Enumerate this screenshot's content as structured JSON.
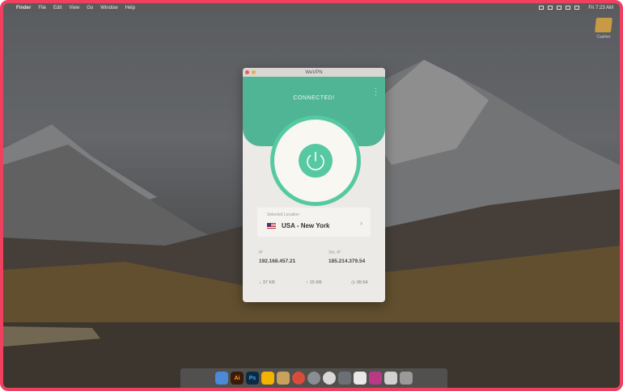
{
  "menubar": {
    "apple": "",
    "menus": [
      "Finder",
      "File",
      "Edit",
      "View",
      "Go",
      "Window",
      "Help"
    ],
    "clock": "Fri 7:23 AM"
  },
  "desktop": {
    "icon_label": "Cashier"
  },
  "app": {
    "title": "WeVPN",
    "status": "CONNECTED!",
    "location_label": "Selected Location",
    "location_value": "USA - New York",
    "ip_label": "IP",
    "ip_value": "192.168.457.21",
    "virtual_ip_label": "Virt. IP",
    "virtual_ip_value": "185.214.379.54",
    "download": "37 KB",
    "upload": "15 KB",
    "timer": "05:54"
  },
  "colors": {
    "accent": "#56c9a3",
    "border": "#f0405f"
  },
  "dock": {
    "items": [
      "finder-icon",
      "illustrator-icon",
      "photoshop-icon",
      "sketch-icon",
      "folder-icon",
      "chrome-icon",
      "launchpad-icon",
      "itunes-icon",
      "preferences-icon",
      "calendar-icon",
      "wevpn-icon",
      "keyboard-icon",
      "trash-icon"
    ]
  }
}
